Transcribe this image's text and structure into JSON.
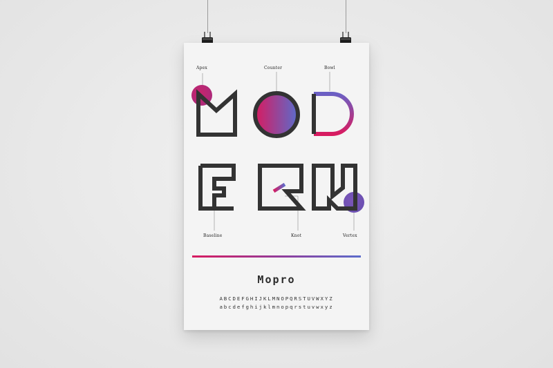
{
  "poster": {
    "headline_row1": "MOD",
    "headline_row2": "ERN",
    "labels": {
      "apex": "Apex",
      "counter": "Counter",
      "bowl": "Bowl",
      "baseline": "Baseline",
      "knot": "Knot",
      "vertex": "Vertex"
    },
    "font_name": "Mopro",
    "uppercase": "ABCDEFGHIJKLMNOPQRSTUVWXYZ",
    "lowercase": "abcdefghijklmnopqrstuvwxyz"
  },
  "colors": {
    "wall": "#e9e9e9",
    "paper": "#f4f4f4",
    "stroke": "#333333",
    "accent_pink": "#d81b60",
    "accent_blue": "#5b6ccb"
  },
  "icons": {
    "left_clip": "binder-clip-icon",
    "right_clip": "binder-clip-icon"
  }
}
